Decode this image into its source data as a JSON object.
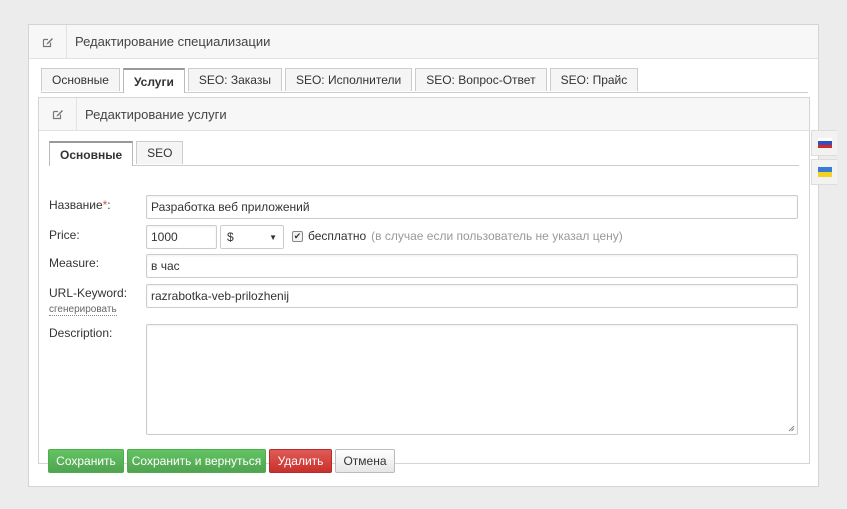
{
  "outer": {
    "title": "Редактирование специализации",
    "icon": "edit-icon",
    "tabs": [
      {
        "label": "Основные",
        "active": false
      },
      {
        "label": "Услуги",
        "active": true
      },
      {
        "label": "SEO: Заказы",
        "active": false
      },
      {
        "label": "SEO: Исполнители",
        "active": false
      },
      {
        "label": "SEO: Вопрос-Ответ",
        "active": false
      },
      {
        "label": "SEO: Прайс",
        "active": false
      }
    ]
  },
  "inner": {
    "title": "Редактирование услуги",
    "icon": "edit-icon",
    "tabs": [
      {
        "label": "Основные",
        "active": true
      },
      {
        "label": "SEO",
        "active": false
      }
    ]
  },
  "form": {
    "name_label": "Название",
    "required_mark": "*",
    "name_colon": ":",
    "name_value": "Разработка веб приложений",
    "price_label": "Price:",
    "price_value": "1000",
    "currency_value": "$",
    "free_label": "бесплатно",
    "free_hint": "(в случае если пользователь не указал цену)",
    "free_checked": true,
    "measure_label": "Measure:",
    "measure_value": "в час",
    "url_label": "URL-Keyword:",
    "url_value": "razrabotka-veb-prilozhenij",
    "generate_link": "сгенерировать",
    "description_label": "Description:",
    "description_value": ""
  },
  "buttons": {
    "save": "Сохранить",
    "save_return": "Сохранить и вернуться",
    "delete": "Удалить",
    "cancel": "Отмена"
  },
  "languages": [
    {
      "name": "ru-flag-icon",
      "colors": [
        "#ffffff",
        "#2f4fc6",
        "#d52b1e"
      ]
    },
    {
      "name": "ua-flag-icon",
      "colors": [
        "#3a7bd5",
        "#f4d21f"
      ]
    }
  ]
}
